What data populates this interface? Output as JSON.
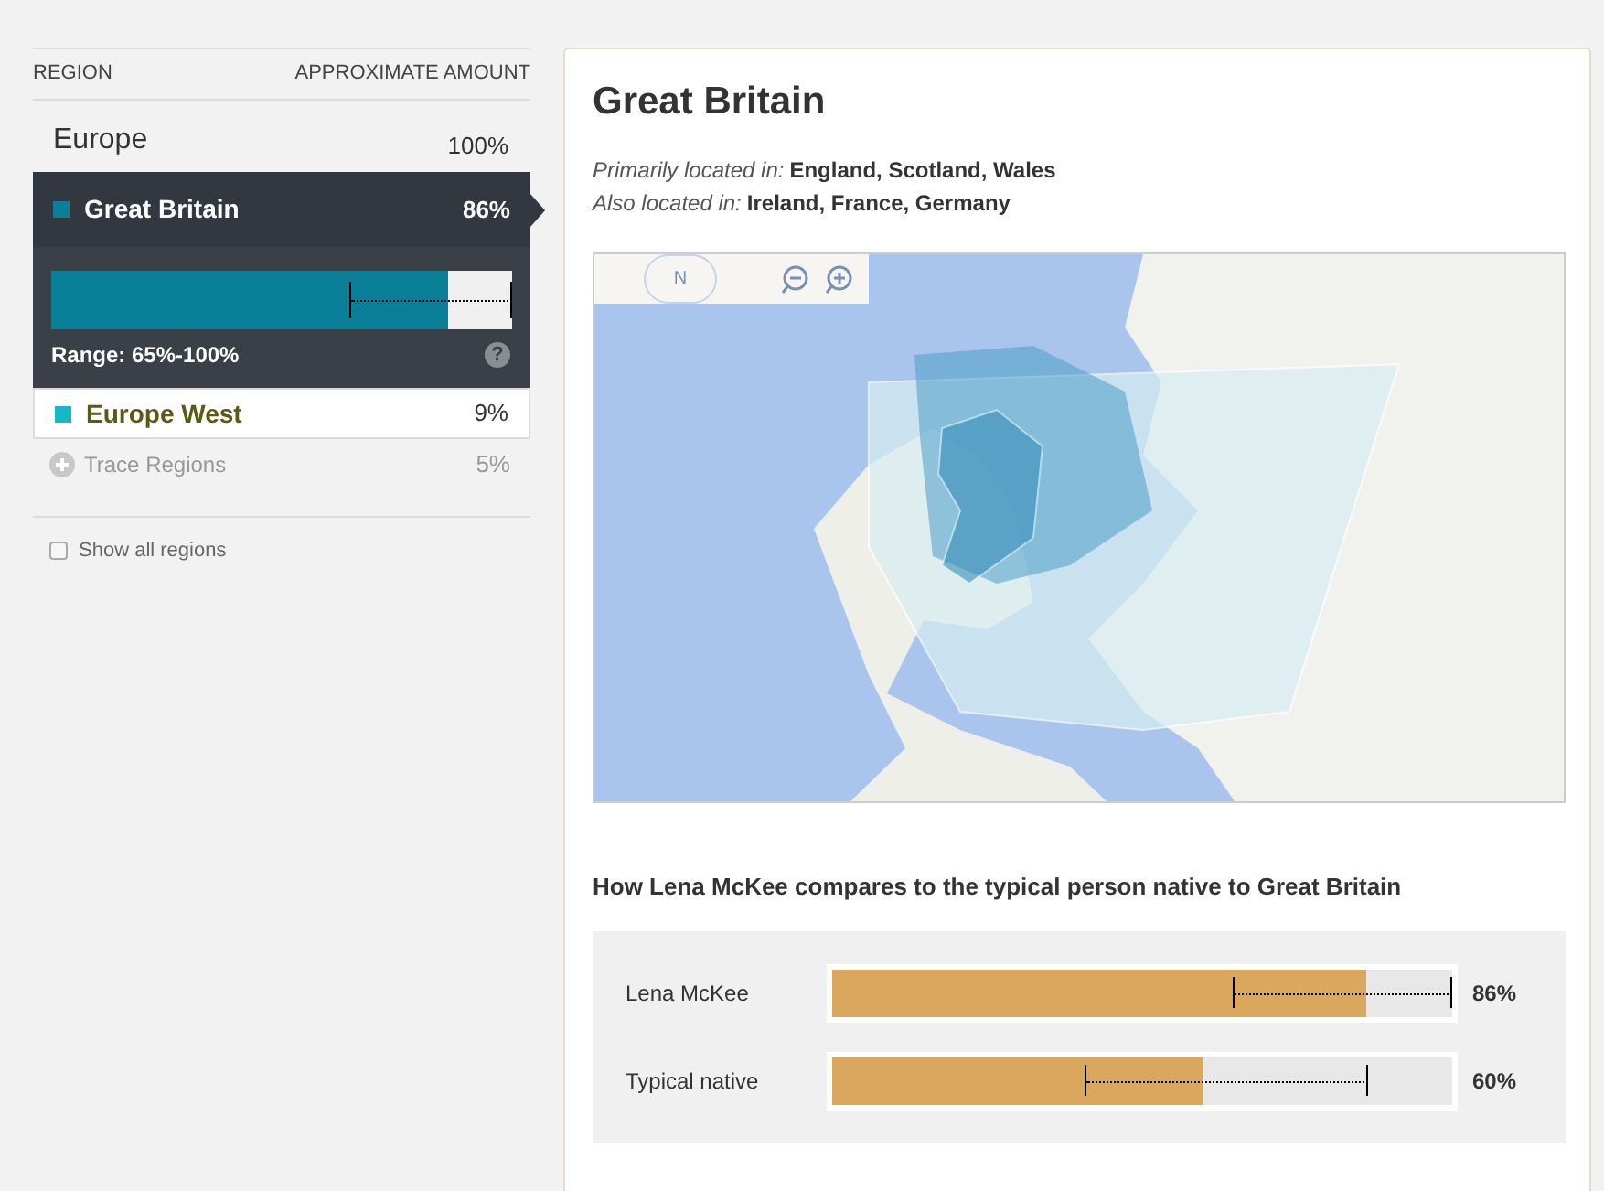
{
  "sidebar": {
    "columns": [
      "REGION",
      "APPROXIMATE AMOUNT"
    ],
    "group": {
      "name": "Europe",
      "amount": "100%"
    },
    "regions": [
      {
        "kind": "detail",
        "name": "Great Britain",
        "amount": "86%",
        "color": "#0a8098",
        "selected": true,
        "level": 0.86,
        "range": {
          "low": {
            "level": 0.65
          },
          "high": {
            "level": 1.0
          }
        },
        "range_text": "Range: 65%-100%",
        "help": "?"
      },
      {
        "kind": "plain",
        "name": "Europe West",
        "amount": "9%",
        "color": "#16b8c8",
        "selected": false
      },
      {
        "kind": "trace",
        "name": "Trace Regions",
        "amount": "5%"
      }
    ],
    "show_all": {
      "label": "Show all regions",
      "checked": false
    }
  },
  "detail": {
    "title": "Great Britain",
    "primarily": {
      "label": "Primarily located in:",
      "places": "England, Scotland, Wales"
    },
    "also": {
      "label": "Also located in:",
      "places": "Ireland, France, Germany"
    },
    "map": {
      "compass": "N"
    },
    "compare": {
      "heading": "How Lena McKee compares to the typical person native to Great Britain",
      "rows": [
        {
          "label": "Lena McKee",
          "level": 0.86,
          "range": {
            "low": {
              "level": 0.65
            },
            "high": {
              "level": 1.0
            }
          },
          "value": "86%"
        },
        {
          "label": "Typical native",
          "level": 0.6,
          "range": {
            "low": {
              "level": 0.41
            },
            "high": {
              "level": 0.865
            }
          },
          "value": "60%"
        }
      ]
    }
  }
}
